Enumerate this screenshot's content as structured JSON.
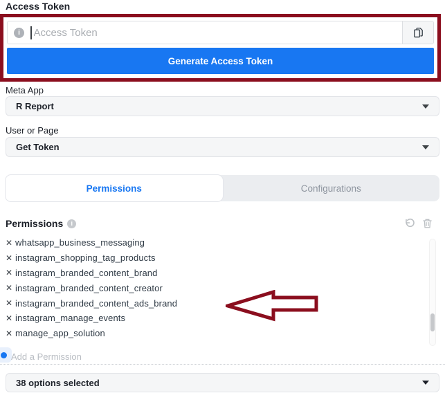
{
  "access_token": {
    "heading": "Access Token",
    "input_placeholder": "Access Token",
    "generate_button": "Generate Access Token"
  },
  "meta_app": {
    "label": "Meta App",
    "value": "R Report"
  },
  "user_or_page": {
    "label": "User or Page",
    "value": "Get Token"
  },
  "tabs": [
    {
      "label": "Permissions",
      "active": true
    },
    {
      "label": "Configurations",
      "active": false
    }
  ],
  "permissions": {
    "heading": "Permissions",
    "items": [
      "whatsapp_business_messaging",
      "instagram_shopping_tag_products",
      "instagram_branded_content_brand",
      "instagram_branded_content_creator",
      "instagram_branded_content_ads_brand",
      "instagram_manage_events",
      "manage_app_solution"
    ],
    "add_placeholder": "Add a Permission",
    "options_selected": "38 options selected"
  },
  "icons": {
    "info_glyph": "i",
    "remove_glyph": "✕"
  },
  "colors": {
    "accent_blue": "#1877f2",
    "annotation_red": "#8b0e1e",
    "tab_inactive_text": "#8d949e",
    "dropdown_bg": "#f5f6f7",
    "text_dark": "#1d2129",
    "placeholder_gray": "#a9adb2"
  }
}
